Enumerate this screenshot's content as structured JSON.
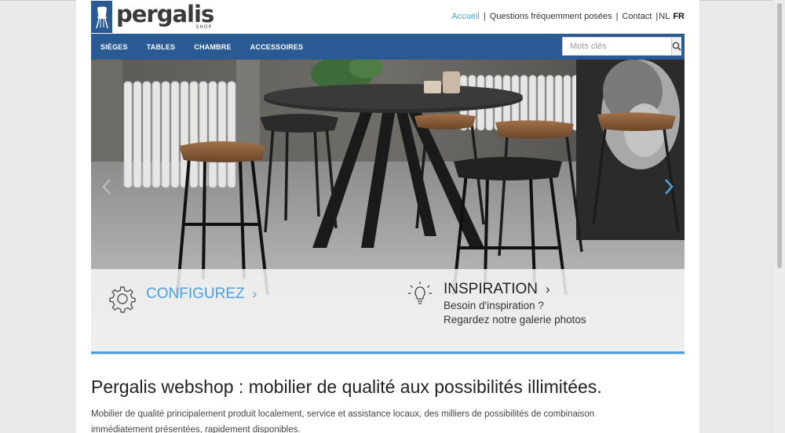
{
  "brand": {
    "name": "pergalis",
    "tagline": "SHOP"
  },
  "top_nav": {
    "links": [
      {
        "label": "Accueil",
        "active": true
      },
      {
        "label": "Questions fréquemment posées",
        "active": false
      },
      {
        "label": "Contact",
        "active": false
      }
    ],
    "languages": [
      {
        "label": "NL",
        "active": false
      },
      {
        "label": "FR",
        "active": true
      }
    ]
  },
  "main_nav": {
    "items": [
      "SIÈGES",
      "TABLES",
      "CHAMBRE",
      "ACCESSOIRES"
    ]
  },
  "search": {
    "placeholder": "Mots clés",
    "value": ""
  },
  "hero": {
    "configure": {
      "title": "CONFIGUREZ",
      "icon": "gear-icon"
    },
    "inspiration": {
      "title": "INSPIRATION",
      "line1": "Besoin d'inspiration ?",
      "line2": "Regardez notre galerie photos",
      "icon": "lightbulb-icon"
    }
  },
  "content": {
    "heading": "Pergalis webshop : mobilier de qualité aux possibilités illimitées.",
    "body": "Mobilier de qualité principalement produit localement, service et assistance locaux, des milliers de possibilités de combinaison immédiatement présentées, rapidement disponibles."
  },
  "colors": {
    "brand_blue": "#2a5a93",
    "accent_blue": "#4aa3df"
  }
}
